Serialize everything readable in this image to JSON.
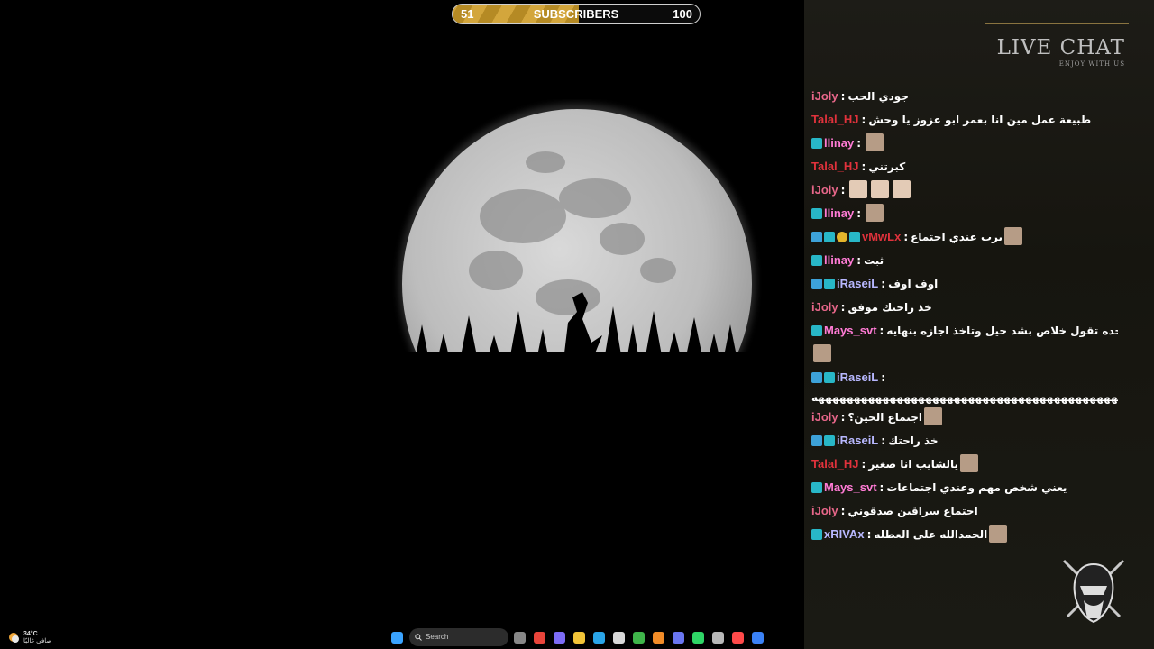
{
  "subscribers": {
    "current": "51",
    "label": "SUBSCRIBERS",
    "goal": "100",
    "progress_fraction": 0.51
  },
  "chat": {
    "title": "LIVE CHAT",
    "subtitle": "ENJOY WITH US",
    "messages": [
      {
        "user": "iJoly",
        "color": "#e8678a",
        "badges": [],
        "text": "جودي الحب",
        "emotes": 0
      },
      {
        "user": "Talal_HJ",
        "color": "#e0323c",
        "badges": [],
        "text": "طبيعة عمل مين انا بعمر ابو عزوز يا وحش",
        "emotes": 0
      },
      {
        "user": "llinay",
        "color": "#ff7bd5",
        "badges": [
          "mod"
        ],
        "text": "",
        "emotes": 1
      },
      {
        "user": "Talal_HJ",
        "color": "#e0323c",
        "badges": [],
        "text": "كبرتني",
        "emotes": 0
      },
      {
        "user": "iJoly",
        "color": "#e8678a",
        "badges": [],
        "text": "",
        "emotes": 3
      },
      {
        "user": "llinay",
        "color": "#ff7bd5",
        "badges": [
          "mod"
        ],
        "text": "",
        "emotes": 1
      },
      {
        "user": "vMwLx",
        "color": "#e0323c",
        "badges": [
          "arrow",
          "mod",
          "gold",
          "mod"
        ],
        "text": "برب عندي اجتماع",
        "emotes": 1
      },
      {
        "user": "llinay",
        "color": "#ff7bd5",
        "badges": [
          "mod"
        ],
        "text": "ثبت",
        "emotes": 0
      },
      {
        "user": "iRaseiL",
        "color": "#b8b8ff",
        "badges": [
          "arrow",
          "mod"
        ],
        "text": "اوف اوف",
        "emotes": 0
      },
      {
        "user": "iJoly",
        "color": "#e8678a",
        "badges": [],
        "text": "خذ راحتك موفق",
        "emotes": 0
      },
      {
        "user": "Mays_svt",
        "color": "#ff7bd5",
        "badges": [
          "mod"
        ],
        "text": "معك وحده تقول خلاص بشد حيل وتاخذ اجازه بنهايه",
        "emotes": 0
      },
      {
        "user": "",
        "color": "#ffffff",
        "badges": [],
        "text": "",
        "emotes": 1
      },
      {
        "user": "iRaseiL",
        "color": "#b8b8ff",
        "badges": [
          "arrow",
          "mod"
        ],
        "text": "",
        "emotes": 0
      },
      {
        "user": "",
        "color": "#ffffff",
        "badges": [],
        "text": "ههههههههههههههههههههههههههههههههههههههههههههه",
        "emotes": 0
      },
      {
        "user": "iJoly",
        "color": "#e8678a",
        "badges": [],
        "text": "اجتماع الحين؟",
        "emotes": 1
      },
      {
        "user": "iRaseiL",
        "color": "#b8b8ff",
        "badges": [
          "arrow",
          "mod"
        ],
        "text": "خذ راحتك",
        "emotes": 0
      },
      {
        "user": "Talal_HJ",
        "color": "#e0323c",
        "badges": [],
        "text": "يالشايب انا صغير",
        "emotes": 1
      },
      {
        "user": "Mays_svt",
        "color": "#ff7bd5",
        "badges": [
          "mod"
        ],
        "text": "يعني شخص مهم وعندي اجتماعات",
        "emotes": 0
      },
      {
        "user": "iJoly",
        "color": "#e8678a",
        "badges": [],
        "text": "اجتماع سراقين صدقوني",
        "emotes": 0
      },
      {
        "user": "xRIVAx",
        "color": "#b8b8ff",
        "badges": [
          "mod"
        ],
        "text": "الحمدالله على العطله",
        "emotes": 1
      }
    ]
  },
  "taskbar": {
    "weather_temp": "34°C",
    "weather_desc": "صافي غالبًا",
    "search_placeholder": "Search",
    "icons": [
      "windows-start-icon",
      "task-view-icon",
      "chrome-icon",
      "copilot-icon",
      "file-explorer-icon",
      "edge-icon",
      "store-icon",
      "xbox-icon",
      "app-a-icon",
      "discord-icon",
      "spotify-icon",
      "terminal-icon",
      "obs-icon",
      "steam-icon"
    ]
  }
}
